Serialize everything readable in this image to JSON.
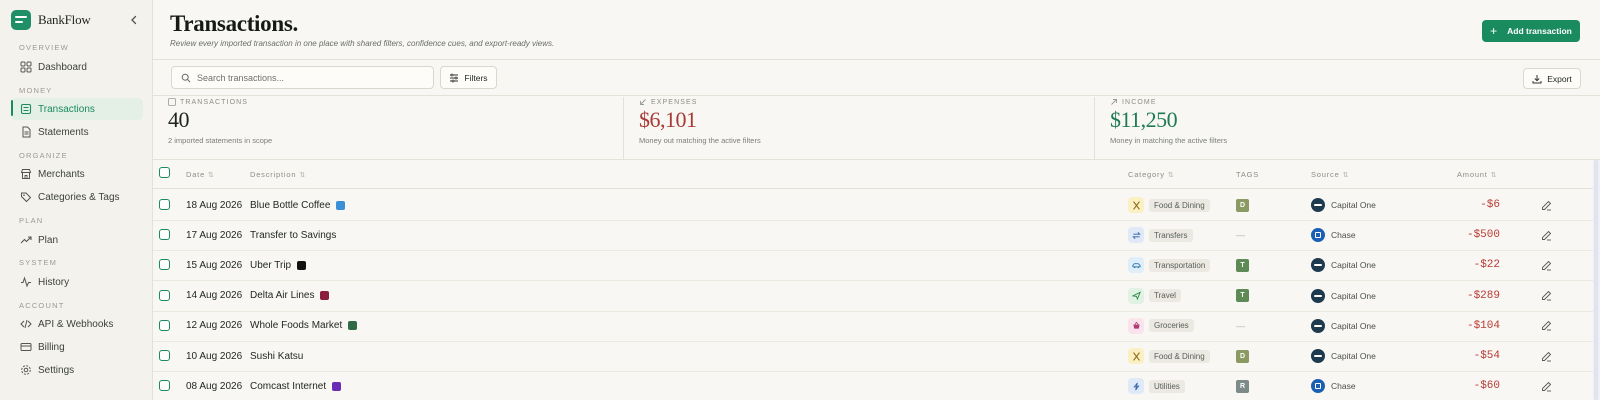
{
  "brand": {
    "name": "BankFlow"
  },
  "sidebar": {
    "sections": [
      {
        "label": "OVERVIEW",
        "items": [
          {
            "label": "Dashboard",
            "icon": "grid-icon"
          }
        ]
      },
      {
        "label": "MONEY",
        "items": [
          {
            "label": "Transactions",
            "icon": "list-icon",
            "active": true
          },
          {
            "label": "Statements",
            "icon": "document-icon"
          }
        ]
      },
      {
        "label": "ORGANIZE",
        "items": [
          {
            "label": "Merchants",
            "icon": "store-icon"
          },
          {
            "label": "Categories & Tags",
            "icon": "tag-icon"
          }
        ]
      },
      {
        "label": "PLAN",
        "items": [
          {
            "label": "Plan",
            "icon": "trend-icon"
          }
        ]
      },
      {
        "label": "SYSTEM",
        "items": [
          {
            "label": "History",
            "icon": "activity-icon"
          }
        ]
      },
      {
        "label": "ACCOUNT",
        "items": [
          {
            "label": "API & Webhooks",
            "icon": "code-icon"
          },
          {
            "label": "Billing",
            "icon": "card-icon"
          },
          {
            "label": "Settings",
            "icon": "gear-icon"
          }
        ]
      }
    ]
  },
  "header": {
    "title": "Transactions.",
    "subtitle": "Review every imported transaction in one place with shared filters, confidence cues, and export-ready views.",
    "add_label": "Add transaction"
  },
  "toolbar": {
    "search_placeholder": "Search transactions...",
    "filters_label": "Filters",
    "export_label": "Export"
  },
  "stats": [
    {
      "label": "TRANSACTIONS",
      "value": "40",
      "caption": "2 imported statements in scope",
      "color": "#1f2420"
    },
    {
      "label": "EXPENSES",
      "value": "$6,101",
      "caption": "Money out matching the active filters",
      "color": "#a83a36"
    },
    {
      "label": "INCOME",
      "value": "$11,250",
      "caption": "Money in matching the active filters",
      "color": "#1f7a55"
    }
  ],
  "table": {
    "columns": {
      "date": "Date",
      "description": "Description",
      "category": "Category",
      "tags": "TAGS",
      "source": "Source",
      "amount": "Amount"
    },
    "rows": [
      {
        "date": "18 Aug 2026",
        "description": "Blue Bottle Coffee",
        "badge_color": "#3b8fd6",
        "category": "Food & Dining",
        "cat_icon": "utensils-icon",
        "cat_bg": "#fbf0c4",
        "cat_fg": "#8a6a12",
        "tag": "D",
        "tag_color": "#8a9a62",
        "source": "Capital One",
        "source_icon": "capital-one-icon",
        "amount": "-$6"
      },
      {
        "date": "17 Aug 2026",
        "description": "Transfer to Savings",
        "badge_color": "",
        "category": "Transfers",
        "cat_icon": "transfer-icon",
        "cat_bg": "#dfe9f7",
        "cat_fg": "#2d5fa8",
        "tag": "",
        "tag_color": "",
        "source": "Chase",
        "source_icon": "chase-icon",
        "amount": "-$500"
      },
      {
        "date": "15 Aug 2026",
        "description": "Uber Trip",
        "badge_color": "#111111",
        "category": "Transportation",
        "cat_icon": "car-icon",
        "cat_bg": "#dfeef8",
        "cat_fg": "#2a7ab0",
        "tag": "T",
        "tag_color": "#5e8a55",
        "source": "Capital One",
        "source_icon": "capital-one-icon",
        "amount": "-$22"
      },
      {
        "date": "14 Aug 2026",
        "description": "Delta Air Lines",
        "badge_color": "#8b1e3f",
        "category": "Travel",
        "cat_icon": "plane-icon",
        "cat_bg": "#e0f2e4",
        "cat_fg": "#2f8a4a",
        "tag": "T",
        "tag_color": "#5e8a55",
        "source": "Capital One",
        "source_icon": "capital-one-icon",
        "amount": "-$289"
      },
      {
        "date": "12 Aug 2026",
        "description": "Whole Foods Market",
        "badge_color": "#2f6b45",
        "category": "Groceries",
        "cat_icon": "basket-icon",
        "cat_bg": "#fbe3ee",
        "cat_fg": "#b23a72",
        "tag": "",
        "tag_color": "",
        "source": "Capital One",
        "source_icon": "capital-one-icon",
        "amount": "-$104"
      },
      {
        "date": "10 Aug 2026",
        "description": "Sushi Katsu",
        "badge_color": "",
        "category": "Food & Dining",
        "cat_icon": "utensils-icon",
        "cat_bg": "#fbf0c4",
        "cat_fg": "#8a6a12",
        "tag": "D",
        "tag_color": "#8a9a62",
        "source": "Capital One",
        "source_icon": "capital-one-icon",
        "amount": "-$54"
      },
      {
        "date": "08 Aug 2026",
        "description": "Comcast Internet",
        "badge_color": "#6a2bb5",
        "category": "Utilities",
        "cat_icon": "bolt-icon",
        "cat_bg": "#dfe9f7",
        "cat_fg": "#2d5fa8",
        "tag": "R",
        "tag_color": "#7d8a8a",
        "source": "Chase",
        "source_icon": "chase-icon",
        "amount": "-$60"
      }
    ]
  },
  "colors": {
    "accent": "#1a8a5f",
    "negative": "#b83b34"
  }
}
